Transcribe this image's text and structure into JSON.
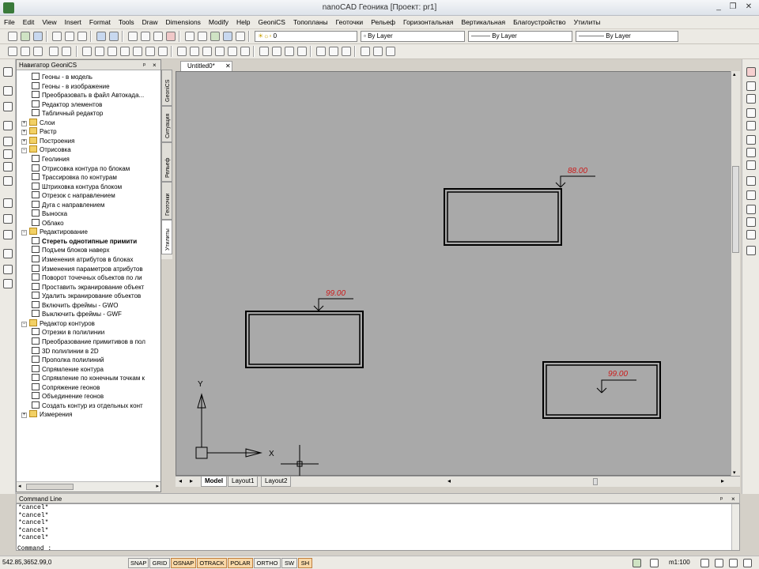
{
  "window": {
    "title": "nanoCAD Геоника [Проект: pr1]",
    "controls": [
      "_",
      "❐",
      "✕"
    ]
  },
  "menu": [
    "File",
    "Edit",
    "View",
    "Insert",
    "Format",
    "Tools",
    "Draw",
    "Dimensions",
    "Modify",
    "Help",
    "GeoniCS",
    "Топопланы",
    "Геоточки",
    "Рельеф",
    "Горизонтальная",
    "Вертикальная",
    "Благоустройство",
    "Утилиты"
  ],
  "layer_combo": {
    "value": "0"
  },
  "property_combos": [
    "By Layer",
    "By Layer",
    "By Layer"
  ],
  "navigator": {
    "title": "Навигатор GeoniCS",
    "header_controls": [
      "ᵖ",
      "×"
    ],
    "tree": [
      {
        "level": 1,
        "kind": "item",
        "label": "Геоны - в модель",
        "expander": ""
      },
      {
        "level": 1,
        "kind": "item",
        "label": "Геоны - в изображение",
        "expander": ""
      },
      {
        "level": 1,
        "kind": "item",
        "label": "Преобразовать в файл Автокада...",
        "expander": ""
      },
      {
        "level": 1,
        "kind": "item",
        "label": "Редактор элементов",
        "expander": ""
      },
      {
        "level": 1,
        "kind": "item",
        "label": "Табличный редактор",
        "expander": ""
      },
      {
        "level": 0,
        "kind": "folder",
        "label": "Слои",
        "expander": "+"
      },
      {
        "level": 0,
        "kind": "folder",
        "label": "Растр",
        "expander": "+"
      },
      {
        "level": 0,
        "kind": "folder",
        "label": "Построения",
        "expander": "+"
      },
      {
        "level": 0,
        "kind": "folder",
        "label": "Отрисовка",
        "expander": "−"
      },
      {
        "level": 1,
        "kind": "item",
        "label": "Геолиния",
        "expander": ""
      },
      {
        "level": 1,
        "kind": "item",
        "label": "Отрисовка контура по блокам",
        "expander": ""
      },
      {
        "level": 1,
        "kind": "item",
        "label": "Трассировка по контурам",
        "expander": ""
      },
      {
        "level": 1,
        "kind": "item",
        "label": "Штриховка контура блоком",
        "expander": ""
      },
      {
        "level": 1,
        "kind": "item",
        "label": "Отрезок с направлением",
        "expander": ""
      },
      {
        "level": 1,
        "kind": "item",
        "label": "Дуга с направлением",
        "expander": ""
      },
      {
        "level": 1,
        "kind": "item",
        "label": "Выноска",
        "expander": ""
      },
      {
        "level": 1,
        "kind": "item",
        "label": "Облако",
        "expander": ""
      },
      {
        "level": 0,
        "kind": "folder",
        "label": "Редактирование",
        "expander": "−"
      },
      {
        "level": 1,
        "kind": "item",
        "label": "Стереть однотипные примити",
        "expander": "",
        "bold": true
      },
      {
        "level": 1,
        "kind": "item",
        "label": "Подъем блоков наверх",
        "expander": ""
      },
      {
        "level": 1,
        "kind": "item",
        "label": "Изменения атрибутов в блоках",
        "expander": ""
      },
      {
        "level": 1,
        "kind": "item",
        "label": "Изменения параметров атрибутов",
        "expander": ""
      },
      {
        "level": 1,
        "kind": "item",
        "label": "Поворот точечных объектов по ли",
        "expander": ""
      },
      {
        "level": 1,
        "kind": "item",
        "label": "Проставить экранирование объект",
        "expander": ""
      },
      {
        "level": 1,
        "kind": "item",
        "label": "Удалить экранирование объектов",
        "expander": ""
      },
      {
        "level": 1,
        "kind": "item",
        "label": "Включить фреймы - GWO",
        "expander": ""
      },
      {
        "level": 1,
        "kind": "item",
        "label": "Выключить фреймы - GWF",
        "expander": ""
      },
      {
        "level": 0,
        "kind": "folder",
        "label": "Редактор контуров",
        "expander": "−"
      },
      {
        "level": 1,
        "kind": "item",
        "label": "Отрезки в полилинии",
        "expander": ""
      },
      {
        "level": 1,
        "kind": "item",
        "label": "Преобразование примитивов в пол",
        "expander": ""
      },
      {
        "level": 1,
        "kind": "item",
        "label": "3D полилинии в 2D",
        "expander": ""
      },
      {
        "level": 1,
        "kind": "item",
        "label": "Прополка полилиний",
        "expander": ""
      },
      {
        "level": 1,
        "kind": "item",
        "label": "Спрямление контура",
        "expander": ""
      },
      {
        "level": 1,
        "kind": "item",
        "label": "Спрямление по конечным точкам к",
        "expander": ""
      },
      {
        "level": 1,
        "kind": "item",
        "label": "Сопряжение геонов",
        "expander": ""
      },
      {
        "level": 1,
        "kind": "item",
        "label": "Объединение геонов",
        "expander": ""
      },
      {
        "level": 1,
        "kind": "item",
        "label": "Создать контур из отдельных конт",
        "expander": ""
      },
      {
        "level": 0,
        "kind": "folder",
        "label": "Измерения",
        "expander": "+"
      }
    ]
  },
  "side_tabs": [
    "GeoniCS",
    "Ситуация",
    "Рельеф",
    "Геоточки",
    "Утилиты"
  ],
  "document_tab": {
    "label": "Untitled0*",
    "close": "✕"
  },
  "drawing": {
    "labels": [
      "88.00",
      "99.00",
      "99.00"
    ],
    "ucs": {
      "x": "X",
      "y": "Y"
    }
  },
  "layout_tabs": [
    "Model",
    "Layout1",
    "Layout2"
  ],
  "command_line": {
    "title": "Command Line",
    "header_controls": [
      "ᵖ",
      "×"
    ],
    "history": [
      "*cancel*",
      "*cancel*",
      "*cancel*",
      "*cancel*",
      "*cancel*"
    ],
    "prompt": "Command :"
  },
  "status_bar": {
    "coords": "542.85,3652.99,0",
    "toggles": [
      {
        "label": "SNAP",
        "on": false
      },
      {
        "label": "GRID",
        "on": false
      },
      {
        "label": "OSNAP",
        "on": true
      },
      {
        "label": "OTRACK",
        "on": true
      },
      {
        "label": "POLAR",
        "on": true
      },
      {
        "label": "ORTHO",
        "on": false
      },
      {
        "label": "SW",
        "on": false
      },
      {
        "label": "SH",
        "on": true
      }
    ],
    "scale": "m1:100"
  },
  "colors": {
    "canvas": "#a9a9a9",
    "annotation_text": "#cc1a1a",
    "toggle_on": "#f8d8a8"
  }
}
